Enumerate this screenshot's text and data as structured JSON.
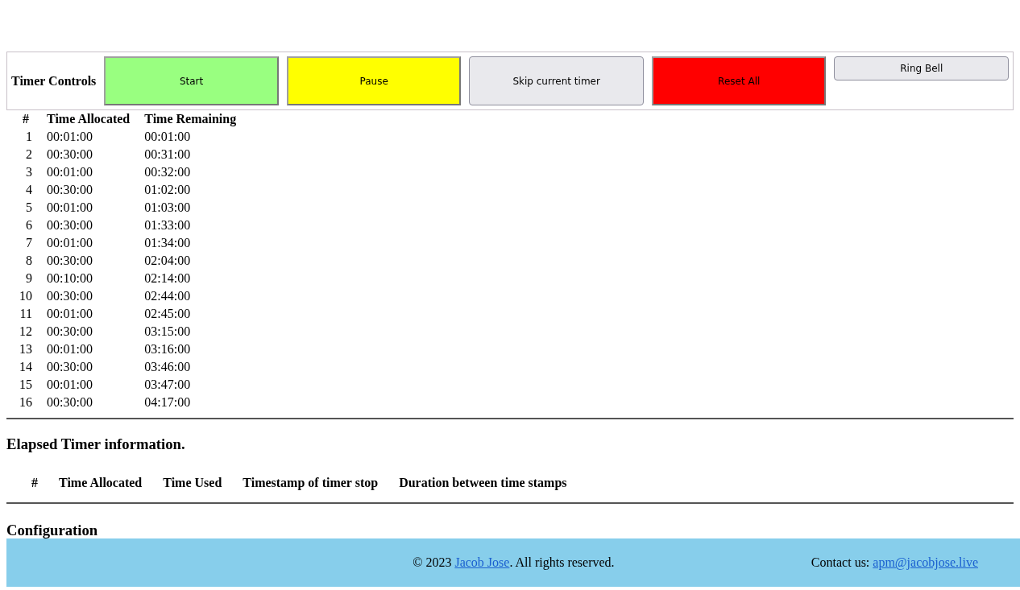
{
  "controls": {
    "label": "Timer Controls",
    "buttons": [
      {
        "label": "Start",
        "kind": "flat",
        "color": "#99ff80"
      },
      {
        "label": "Pause",
        "kind": "flat",
        "color": "#ffff00"
      },
      {
        "label": "Skip current timer",
        "kind": "native",
        "color": "#e9e9ed"
      },
      {
        "label": "Reset All",
        "kind": "flat",
        "color": "#ff0000"
      },
      {
        "label": "Ring Bell",
        "kind": "small",
        "color": "#e9e9ed"
      }
    ]
  },
  "timers": {
    "columns": [
      "#",
      "Time Allocated",
      "Time Remaining"
    ],
    "rows": [
      [
        "1",
        "00:01:00",
        "00:01:00"
      ],
      [
        "2",
        "00:30:00",
        "00:31:00"
      ],
      [
        "3",
        "00:01:00",
        "00:32:00"
      ],
      [
        "4",
        "00:30:00",
        "01:02:00"
      ],
      [
        "5",
        "00:01:00",
        "01:03:00"
      ],
      [
        "6",
        "00:30:00",
        "01:33:00"
      ],
      [
        "7",
        "00:01:00",
        "01:34:00"
      ],
      [
        "8",
        "00:30:00",
        "02:04:00"
      ],
      [
        "9",
        "00:10:00",
        "02:14:00"
      ],
      [
        "10",
        "00:30:00",
        "02:44:00"
      ],
      [
        "11",
        "00:01:00",
        "02:45:00"
      ],
      [
        "12",
        "00:30:00",
        "03:15:00"
      ],
      [
        "13",
        "00:01:00",
        "03:16:00"
      ],
      [
        "14",
        "00:30:00",
        "03:46:00"
      ],
      [
        "15",
        "00:01:00",
        "03:47:00"
      ],
      [
        "16",
        "00:30:00",
        "04:17:00"
      ]
    ]
  },
  "elapsed": {
    "title": "Elapsed Timer information.",
    "columns": [
      "#",
      "Time Allocated",
      "Time Used",
      "Timestamp of timer stop",
      "Duration between time stamps"
    ]
  },
  "configuration": {
    "title": "Configuration"
  },
  "footer": {
    "copyright_prefix": "© 2023",
    "author_link": "Jacob Jose",
    "copyright_suffix": ". All rights reserved.",
    "contact_label": "Contact us:",
    "email_link": "apm@jacobjose.live"
  }
}
